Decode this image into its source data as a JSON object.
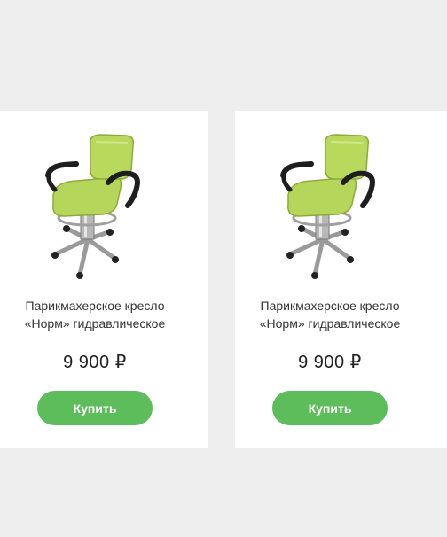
{
  "colors": {
    "page_background": "#eeeeee",
    "card_background": "#ffffff",
    "button": "#5dbd5a",
    "button_text": "#ffffff",
    "seat": "#b5d65a"
  },
  "products": [
    {
      "image_icon": "barber-chair-image",
      "title_line1": "Парикмахерское кресло",
      "title_line2": "«Норм» гидравлическое",
      "price": "9 900 ₽",
      "buy_label": "Купить"
    },
    {
      "image_icon": "barber-chair-image",
      "title_line1": "Парикмахерское кресло",
      "title_line2": "«Норм» гидравлическое",
      "price": "9 900 ₽",
      "buy_label": "Купить"
    }
  ]
}
